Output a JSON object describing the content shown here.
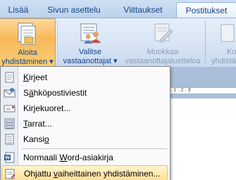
{
  "tabs": [
    "Lisää",
    "Sivun asettelu",
    "Viittaukset",
    "Postitukset"
  ],
  "active_tab": "Postitukset",
  "ribbon": {
    "start_merge": {
      "line1": "Aloita",
      "line2": "yhdistäminen",
      "arrow": "▾"
    },
    "select_recipients": {
      "line1": "Valitse",
      "line2": "vastaanottajat",
      "arrow": "▾"
    },
    "edit_recipients": {
      "line1": "Muokkaa",
      "line2": "vastaanottajaluetteloa"
    },
    "next_group": {
      "line1": "Ko",
      "line2": "yhdistä"
    }
  },
  "ruler_text": "· 2 · 1 · 2 · 3",
  "menu": {
    "items": [
      {
        "pre": "",
        "u": "K",
        "post": "irjeet",
        "icon": "letter-icon"
      },
      {
        "pre": "S",
        "u": "ä",
        "post": "hköpostiviestit",
        "icon": "email-icon"
      },
      {
        "pre": "Kir",
        "u": "j",
        "post": "ekuoret...",
        "icon": "envelope-icon"
      },
      {
        "pre": "",
        "u": "T",
        "post": "arrat...",
        "icon": "labels-icon"
      },
      {
        "pre": "Kansi",
        "u": "o",
        "post": "",
        "icon": "directory-icon"
      },
      {
        "pre": "Normaali ",
        "u": "W",
        "post": "ord-asiakirja",
        "icon": "word-document-icon"
      },
      {
        "pre": "Ohjattu ",
        "u": "v",
        "post": "aiheittainen yhdistäminen...",
        "icon": "wizard-icon"
      }
    ]
  },
  "colors": {
    "accent": "#15428b",
    "highlight": "#fddf93",
    "pressed": "#f8b95b"
  }
}
